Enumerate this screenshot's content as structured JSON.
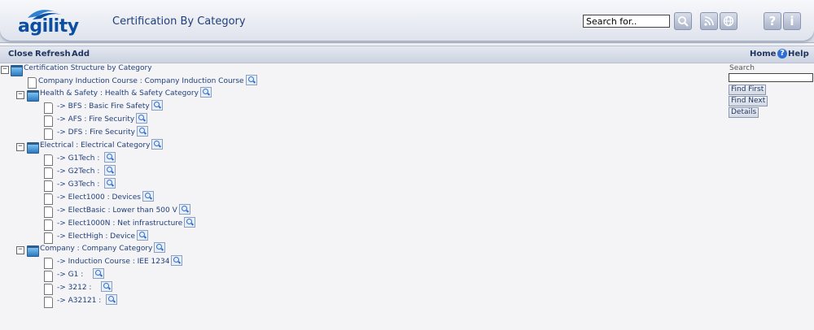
{
  "app": {
    "logo_text": "agility",
    "page_title": "Certification By Category"
  },
  "search": {
    "value": "Search for.."
  },
  "header_buttons": [
    {
      "name": "search-go",
      "icon": "magnifier-icon"
    },
    {
      "name": "rss",
      "icon": "rss-icon"
    },
    {
      "name": "globe",
      "icon": "globe-icon"
    },
    {
      "name": "help",
      "icon": "question-icon",
      "label": "?"
    },
    {
      "name": "info",
      "icon": "info-icon",
      "label": "i"
    }
  ],
  "toolbar": {
    "close_label": "Close",
    "refresh_label": "Refresh",
    "add_label": "Add",
    "home_label": "Home",
    "help_label": "Help"
  },
  "tree": {
    "root_label": "Certification Structure by Category",
    "induction_label": "Company Induction Course : Company Induction Course",
    "hs": {
      "label": "Health & Safety : Health & Safety Category",
      "items": [
        "-> BFS : Basic Fire Safety",
        "-> AFS : Fire Security",
        "-> DFS : Fire Security"
      ]
    },
    "el": {
      "label": "Electrical : Electrical Category",
      "items": [
        "-> G1Tech :",
        "-> G2Tech :",
        "-> G3Tech :",
        "-> Elect1000 : Devices",
        "-> ElectBasic : Lower than 500 V",
        "-> Elect1000N : Net infrastructure",
        "-> ElectHigh : Device"
      ]
    },
    "co": {
      "label": "Company : Company Category",
      "items": [
        "-> Induction Course : IEE 1234",
        "-> G1 :",
        "-> 3212 :",
        "-> A32121 :"
      ]
    }
  },
  "side": {
    "title": "Search",
    "input_value": "",
    "find_first": "Find First",
    "find_next": "Find Next",
    "details": "Details"
  }
}
